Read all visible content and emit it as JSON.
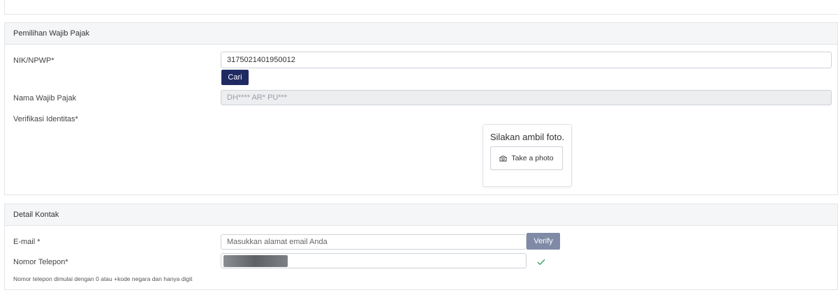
{
  "wajib_pajak_section": {
    "title": "Pemilihan Wajib Pajak",
    "nik_label": "NIK/NPWP*",
    "nik_value": "3175021401950012",
    "search_button": "Cari",
    "nama_label": "Nama Wajib Pajak",
    "nama_value": "DH**** AR* PU***",
    "verifikasi_label": "Verifikasi Identitas*",
    "photo_prompt": "Silakan ambil foto.",
    "take_photo_button": "Take a photo",
    "take_photo_icon": "camera-icon"
  },
  "kontak_section": {
    "title": "Detail Kontak",
    "email_label": "E-mail *",
    "email_placeholder": "Masukkan alamat email Anda",
    "verify_button": "Verify",
    "phone_label": "Nomor Telepon*",
    "phone_status_icon": "checkmark-icon",
    "phone_hint": "Nomor telepon dimulai dengan 0 atau +kode negara dan hanya digit"
  },
  "colors": {
    "primary_button": "#1f2a63",
    "verify_button": "#7f8aa6",
    "success": "#2e9e4f"
  }
}
